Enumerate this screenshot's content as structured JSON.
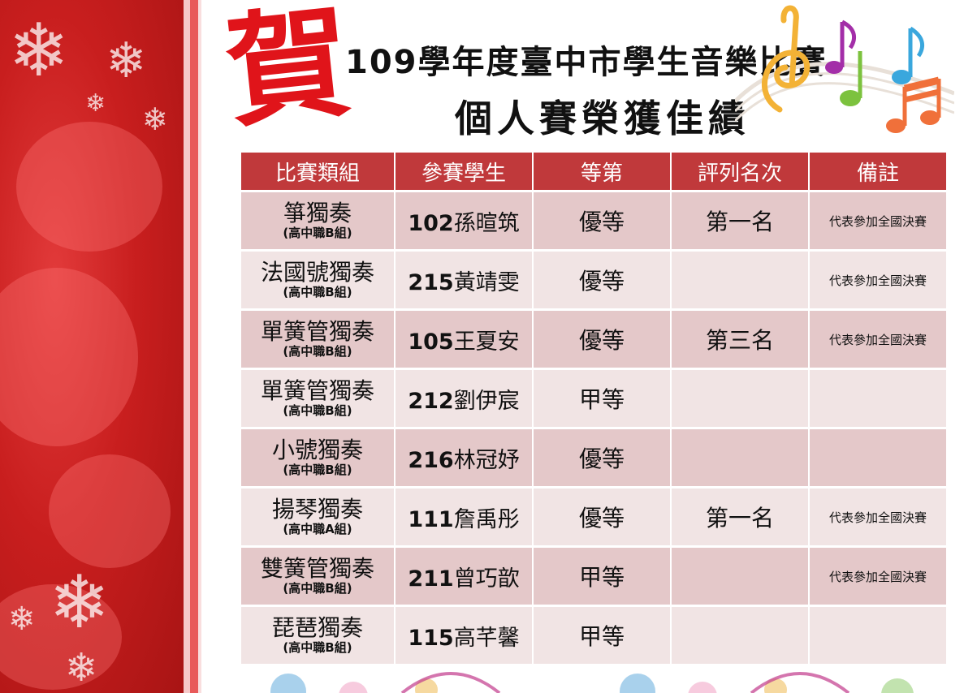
{
  "header": {
    "he_char": "賀",
    "title_line1": "109學年度臺中市學生音樂比賽",
    "title_line2": "個人賽榮獲佳績"
  },
  "table": {
    "headers": [
      "比賽類組",
      "參賽學生",
      "等第",
      "評列名次",
      "備註"
    ],
    "rows": [
      {
        "category": "箏獨奏",
        "division": "(高中職B組)",
        "student_no": "102",
        "student_name": "孫暄筑",
        "grade": "優等",
        "rank": "第一名",
        "note": "代表參加全國決賽"
      },
      {
        "category": "法國號獨奏",
        "division": "(高中職B組)",
        "student_no": "215",
        "student_name": "黃靖雯",
        "grade": "優等",
        "rank": "",
        "note": "代表參加全國決賽"
      },
      {
        "category": "單簧管獨奏",
        "division": "(高中職B組)",
        "student_no": "105",
        "student_name": "王夏安",
        "grade": "優等",
        "rank": "第三名",
        "note": "代表參加全國決賽"
      },
      {
        "category": "單簧管獨奏",
        "division": "(高中職B組)",
        "student_no": "212",
        "student_name": "劉伊宸",
        "grade": "甲等",
        "rank": "",
        "note": ""
      },
      {
        "category": "小號獨奏",
        "division": "(高中職B組)",
        "student_no": "216",
        "student_name": "林冠妤",
        "grade": "優等",
        "rank": "",
        "note": ""
      },
      {
        "category": "揚琴獨奏",
        "division": "(高中職A組)",
        "student_no": "111",
        "student_name": "詹禹彤",
        "grade": "優等",
        "rank": "第一名",
        "note": "代表參加全國決賽"
      },
      {
        "category": "雙簧管獨奏",
        "division": "(高中職B組)",
        "student_no": "211",
        "student_name": "曾巧歆",
        "grade": "甲等",
        "rank": "",
        "note": "代表參加全國決賽"
      },
      {
        "category": "琵琶獨奏",
        "division": "(高中職B組)",
        "student_no": "115",
        "student_name": "高芊馨",
        "grade": "甲等",
        "rank": "",
        "note": ""
      }
    ]
  },
  "colors": {
    "header_red": "#c0393b",
    "row_dark": "#e4c8c9",
    "row_light": "#f1e4e4",
    "he_red": "#e0141a"
  },
  "decor": {
    "side_panel": "snowflake-pattern",
    "music_notes": "music-notes-icon"
  }
}
